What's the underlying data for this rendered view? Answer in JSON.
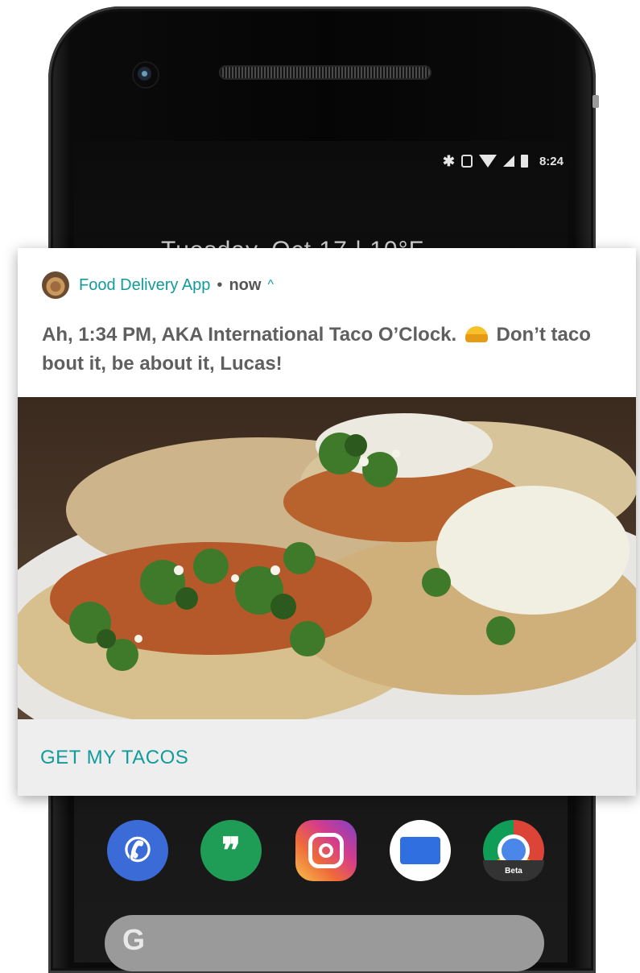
{
  "status_bar": {
    "time": "8:24"
  },
  "lock_screen": {
    "date_partial": "Tuesday, Oct 17 | 10°F"
  },
  "notification": {
    "app_name": "Food Delivery App",
    "separator": "•",
    "time": "now",
    "expand_glyph": "^",
    "message_part1": "Ah, 1:34 PM, AKA International Taco O’Clock.",
    "message_part2": "Don’t taco bout it, be about it, Lucas!",
    "action_label": "GET MY TACOS"
  },
  "dock": {
    "apps": [
      "phone",
      "hangouts",
      "instagram",
      "inbox",
      "chrome-beta"
    ],
    "chrome_badge": "Beta"
  },
  "search": {
    "logo_letter": "G"
  },
  "colors": {
    "accent": "#139b9b",
    "text_muted": "#5f5f5f",
    "action_bg": "#eeeeee"
  },
  "icons": [
    "bluetooth-icon",
    "vibrate-icon",
    "wifi-icon",
    "cell-signal-icon",
    "battery-icon",
    "phone-icon",
    "hangouts-icon",
    "instagram-icon",
    "inbox-icon",
    "chrome-beta-icon",
    "google-g-icon"
  ]
}
